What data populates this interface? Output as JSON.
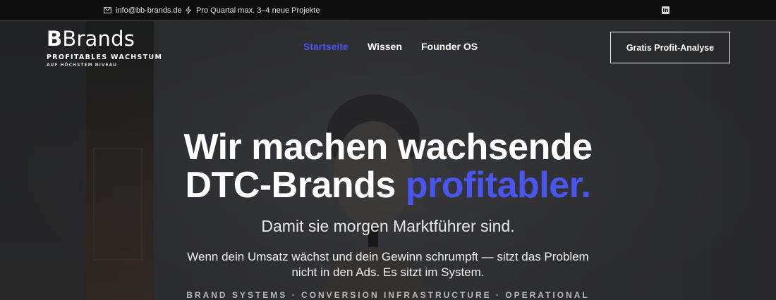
{
  "topbar": {
    "email": "info@bb-brands.de",
    "email_icon": "mail-icon",
    "capacity": "Pro Quartal max. 3–4 neue Projekte",
    "capacity_icon": "bolt-icon",
    "social_icon": "linkedin-icon"
  },
  "logo": {
    "brand_text": "Brands",
    "brand_initial": "B",
    "tagline": "PROFITABLES WACHSTUM",
    "subtagline": "AUF HÖCHSTEM NIVEAU"
  },
  "nav": {
    "items": [
      {
        "label": "Startseite",
        "active": true
      },
      {
        "label": "Wissen",
        "active": false
      },
      {
        "label": "Founder OS",
        "active": false
      }
    ],
    "cta_label": "Gratis Profit-Analyse"
  },
  "hero": {
    "headline_line1": "Wir machen wachsende",
    "headline_line2_start": "DTC-Brands ",
    "headline_accent": "profitabler.",
    "subheadline": "Damit sie morgen Marktführer sind.",
    "paragraph": "Wenn dein Umsatz wächst und dein Gewinn schrumpft — sitzt das Problem nicht in den Ads. Es sitzt im System.",
    "tagline": "BRAND SYSTEMS · CONVERSION INFRASTRUCTURE · OPERATIONAL"
  },
  "colors": {
    "accent": "#4a55f0",
    "topbar_bg": "#0d0d0e",
    "hero_bg": "#333437"
  }
}
